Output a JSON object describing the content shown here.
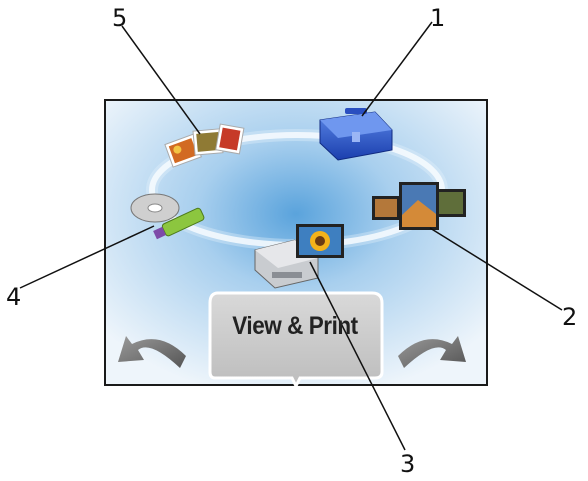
{
  "mode_label": "View & Print",
  "callouts": [
    {
      "number": "1",
      "icon": "toolbox-icon"
    },
    {
      "number": "2",
      "icon": "photo-slideshow-icon"
    },
    {
      "number": "3",
      "icon": "printer-photo-icon"
    },
    {
      "number": "4",
      "icon": "cd-usb-drive-icon"
    },
    {
      "number": "5",
      "icon": "photos-icon"
    }
  ],
  "colors": {
    "frame_border": "#1a1a1a",
    "background_center": "#6fb0e0",
    "background_edge": "#e8f2fa",
    "label_box": "#c8c8c8",
    "arrow": "#7a7a7a"
  }
}
